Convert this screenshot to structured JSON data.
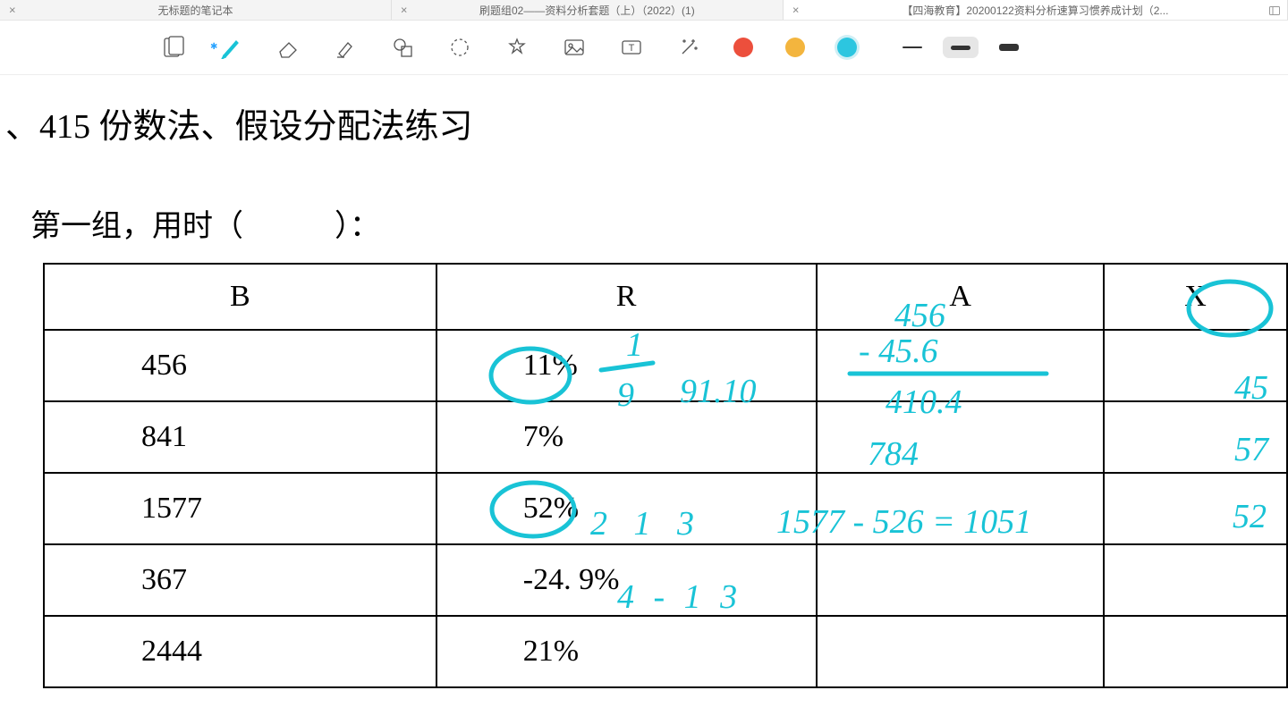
{
  "tabs": [
    {
      "label": "无标题的笔记本"
    },
    {
      "label": "刷题组02——资料分析套题（上）（2022）(1)"
    },
    {
      "label": "【四海教育】20200122资料分析速算习惯养成计划（2..."
    }
  ],
  "toolbar": {
    "colors": {
      "red": "#ec4f3c",
      "yellow": "#f3b53e",
      "cyan": "#2cc6e0"
    },
    "selected_color": "cyan",
    "selected_stroke": 2
  },
  "doc": {
    "title_prefix": "、",
    "title": "415 份数法、假设分配法练习",
    "group_label": "第一组，用时（　　　）："
  },
  "table": {
    "headers": {
      "b": "B",
      "r": "R",
      "a": "A",
      "x": "X"
    },
    "rows": [
      {
        "b": "456",
        "r": "11%"
      },
      {
        "b": "841",
        "r": "7%"
      },
      {
        "b": "1577",
        "r": "52%"
      },
      {
        "b": "367",
        "r": "-24. 9%"
      },
      {
        "b": "2444",
        "r": "21%"
      }
    ]
  },
  "annotations": {
    "a_header_note": "456",
    "row1_r_fraction_top": "1",
    "row1_r_fraction_bottom": "9",
    "row1_r_side": "91.10",
    "row1_a_top": "456",
    "row1_a_mid": "- 45.6",
    "row1_a_bot": "410.4",
    "row1_x": "45",
    "row2_a": "784",
    "row2_x": "57",
    "row3_r_side": "2 1 3",
    "row3_a": "1577 - 526 = 1051",
    "row3_x": "52",
    "row4_r_side": "4 - 1 3"
  }
}
